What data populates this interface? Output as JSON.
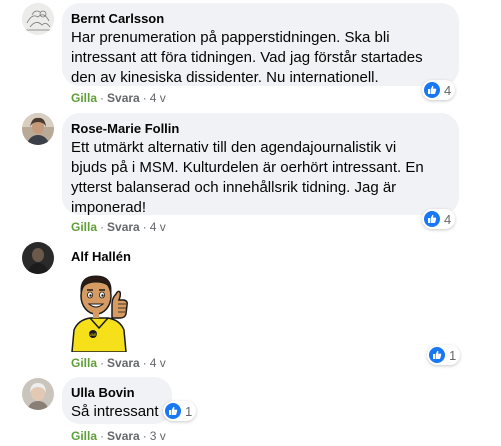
{
  "colors": {
    "bubble": "#f0f2f5",
    "like_blue": "#1877f2",
    "meta_gray": "#65676b",
    "like_label": "#5f9f3a"
  },
  "comments": [
    {
      "author": "Bernt Carlsson",
      "lines": [
        "Har prenumeration på papperstidningen. Ska bli",
        "intressant att föra tidningen. Vad jag förstår startades",
        "den av kinesiska dissidenter. Nu internationell."
      ],
      "like": "Gilla",
      "reply": "Svara",
      "time": "4 v",
      "reactions": "4",
      "reaction_icon": "thumbs-up-icon"
    },
    {
      "author": "Rose-Marie Follin",
      "lines": [
        "Ett utmärkt alternativ till den agendajournalistik vi",
        "bjuds på i MSM. Kulturdelen är oerhört intressant. En",
        "ytterst balanserad och innehållsrik tidning. Jag är",
        "imponerad!"
      ],
      "like": "Gilla",
      "reply": "Svara",
      "time": "4 v",
      "reactions": "4",
      "reaction_icon": "thumbs-up-icon"
    },
    {
      "author": "Alf Hallén",
      "sticker": "thumbs-up-referee-sticker",
      "like": "Gilla",
      "reply": "Svara",
      "time": "4 v",
      "reactions": "1",
      "reaction_icon": "thumbs-up-icon"
    },
    {
      "author": "Ulla Bovin",
      "text": "Så intressant",
      "like": "Gilla",
      "reply": "Svara",
      "time": "3 v",
      "reactions": "1",
      "reaction_icon": "thumbs-up-icon"
    }
  ]
}
